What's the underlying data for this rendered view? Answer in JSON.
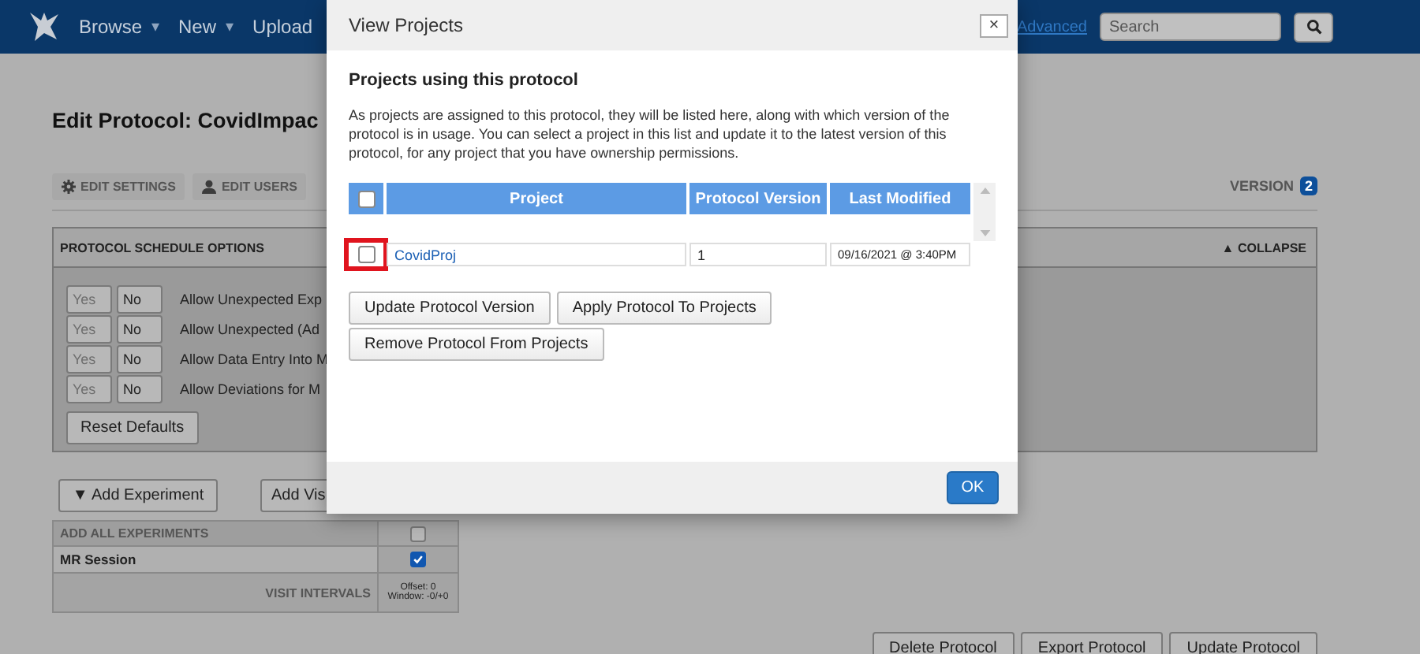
{
  "navbar": {
    "menus": [
      {
        "label": "Browse",
        "caret": "▾"
      },
      {
        "label": "New",
        "caret": "▾"
      },
      {
        "label": "Upload"
      }
    ],
    "advanced_link": "Advanced",
    "search": {
      "placeholder": "Search"
    }
  },
  "page": {
    "title": "Edit Protocol: CovidImpac",
    "toolbar": [
      {
        "label": "EDIT SETTINGS",
        "kind": "settings"
      },
      {
        "label": "EDIT USERS",
        "kind": "users"
      }
    ],
    "version_label": "VERSION",
    "version": "2"
  },
  "schedule_panel": {
    "title": "PROTOCOL SCHEDULE OPTIONS",
    "collapse_arrow": "▲",
    "collapse": "COLLAPSE",
    "options": [
      {
        "yes": "Yes",
        "no": "No",
        "label": "Allow Unexpected Exp"
      },
      {
        "yes": "Yes",
        "no": "No",
        "label": "Allow Unexpected (Ad"
      },
      {
        "yes": "Yes",
        "no": "No",
        "label": "Allow Data Entry Into M"
      },
      {
        "yes": "Yes",
        "no": "No",
        "label": "Allow Deviations for M"
      }
    ],
    "reset": "Reset Defaults"
  },
  "experiments": {
    "add_arrow": "▼",
    "add_experiment": "Add Experiment",
    "add_visit": "Add Vis",
    "rows": [
      {
        "label": "ADD ALL EXPERIMENTS",
        "kind": "header",
        "checked": false
      },
      {
        "label": "MR Session",
        "kind": "experiment",
        "checked": true
      }
    ],
    "intervals_label": "VISIT INTERVALS",
    "intervals": [
      "Offset: 0",
      "Window: -0/+0"
    ]
  },
  "footer_buttons": [
    "Delete Protocol",
    "Export Protocol",
    "Update Protocol"
  ],
  "dialog": {
    "title": "View Projects",
    "close": "×",
    "heading": "Projects using this protocol",
    "text": "As projects are assigned to this protocol, they will be listed here, along with which version of the protocol is in usage. You can select a project in this list and update it to the latest version of this protocol, for any project that you have ownership permissions.",
    "table": {
      "header_checked": false,
      "columns": [
        "Project",
        "Protocol Version",
        "Last Modified"
      ],
      "rows": [
        {
          "checked": false,
          "highlighted": true,
          "project": "CovidProj",
          "version": "1",
          "modified": "09/16/2021 @ 3:40PM"
        }
      ]
    },
    "buttons": [
      "Update Protocol Version",
      "Apply Protocol To Projects",
      "Remove Protocol From Projects"
    ],
    "ok": "OK"
  }
}
